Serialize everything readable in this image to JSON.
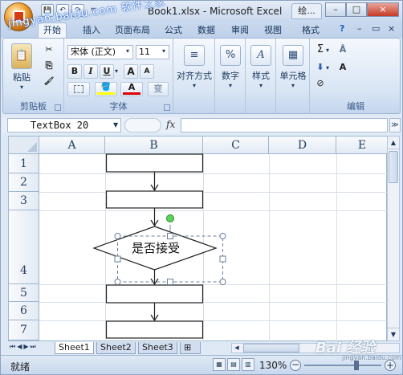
{
  "window": {
    "title": "Book1.xlsx - Microsoft Excel",
    "title_tab": "绘...",
    "minimize": "–",
    "restore": "□",
    "close": "×"
  },
  "watermark_top": "jingyan.baidu.com 软件之家",
  "quick_access": {
    "save": "💾",
    "undo": "↶",
    "redo": "↷",
    "customize": "="
  },
  "tabs": [
    "开始",
    "插入",
    "页面布局",
    "公式",
    "数据",
    "审阅",
    "视图",
    "格式"
  ],
  "tabs_right": {
    "help": "?",
    "minimize": "–",
    "restore": "▭",
    "close": "×"
  },
  "ribbon": {
    "clipboard": {
      "label": "剪贴板",
      "paste": "粘贴",
      "cut": "✂",
      "copy": "⎘",
      "format_painter": "🖌"
    },
    "font": {
      "label": "字体",
      "font_name": "宋体 (正文)",
      "font_size": "11",
      "bold": "B",
      "italic": "I",
      "underline": "U",
      "grow": "A",
      "shrink": "A",
      "fill_color": "#ffff00",
      "font_color": "#e00000",
      "phonetic": "变"
    },
    "alignment": {
      "label": "对齐方式"
    },
    "number": {
      "label": "数字",
      "icon": "%"
    },
    "styles": {
      "label": "样式",
      "icon": "A"
    },
    "cells": {
      "label": "单元格"
    },
    "editing": {
      "label": "编辑",
      "sum": "Σ",
      "sort": "Å",
      "find": "A",
      "clear": "⊘"
    }
  },
  "formula_bar": {
    "name_box": "TextBox 20",
    "fx": "fx",
    "formula": ""
  },
  "columns": [
    "A",
    "B",
    "C",
    "D",
    "E"
  ],
  "rows": [
    "1",
    "2",
    "3",
    "4",
    "5",
    "6",
    "7"
  ],
  "flowchart": {
    "decision_text": "是否接受"
  },
  "sheets": [
    "Sheet1",
    "Sheet2",
    "Sheet3"
  ],
  "status": {
    "ready": "就绪",
    "zoom": "130%",
    "zoom_minus": "−",
    "zoom_plus": "+"
  },
  "watermark_bottom": {
    "main": "Bai 经验",
    "sub": "jingyan.baidu.com"
  }
}
